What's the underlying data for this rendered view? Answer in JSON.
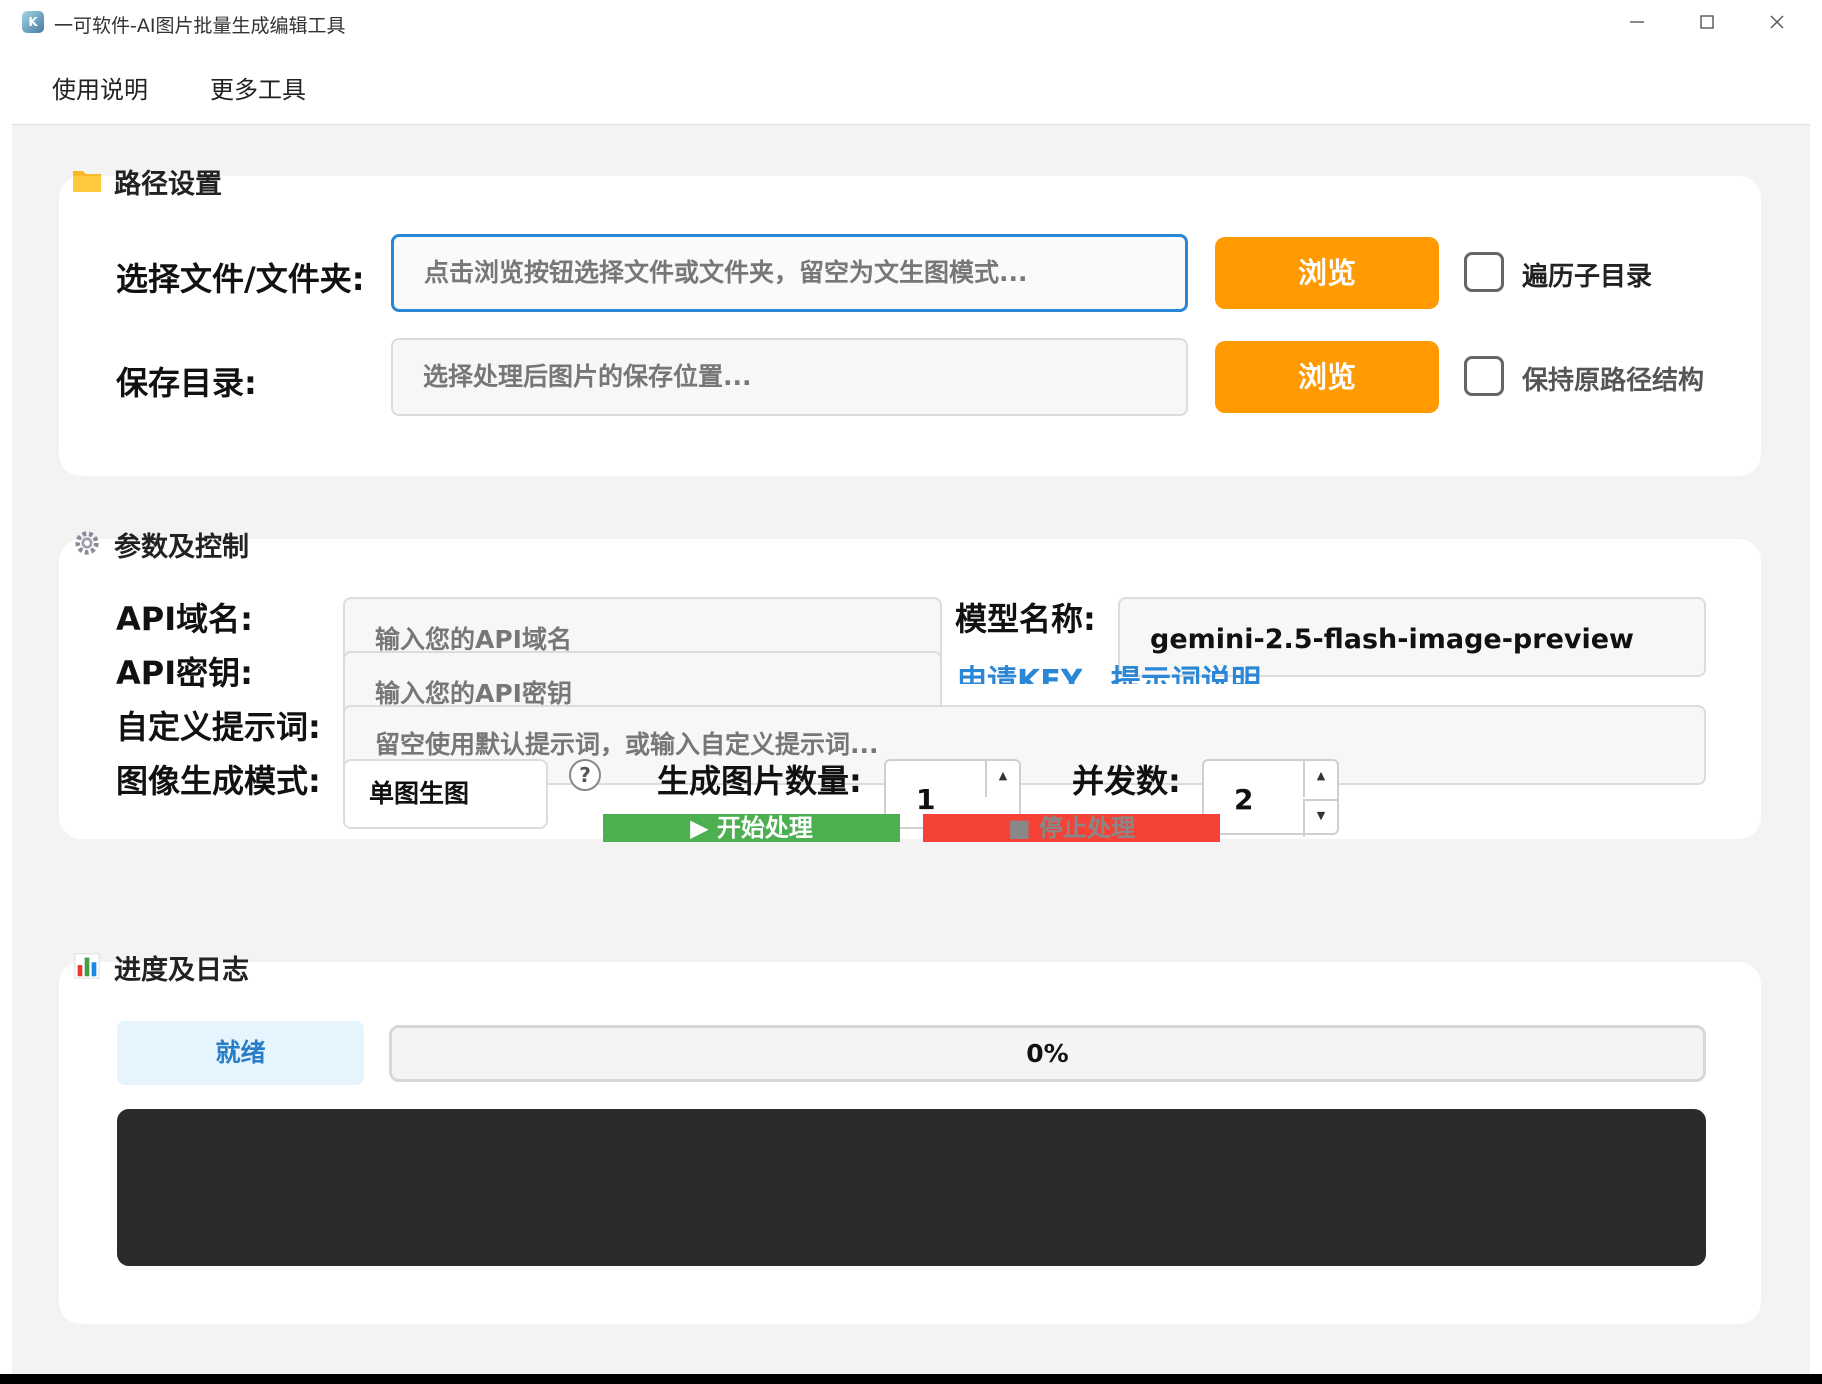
{
  "window": {
    "title": "一可软件-AI图片批量生成编辑工具"
  },
  "menu": [
    "使用说明",
    "更多工具"
  ],
  "path_section": {
    "title": "路径设置",
    "file_label": "选择文件/文件夹:",
    "file_placeholder": "点击浏览按钮选择文件或文件夹，留空为文生图模式...",
    "browse_label": "浏览",
    "recursive_label": "遍历子目录",
    "save_label": "保存目录:",
    "save_placeholder": "选择处理后图片的保存位置...",
    "browse2_label": "浏览",
    "keep_struct_label": "保持原路径结构"
  },
  "params_section": {
    "title": "参数及控制",
    "api_domain_label": "API域名:",
    "api_domain_placeholder": "输入您的API域名",
    "api_key_label": "API密钥:",
    "api_key_placeholder": "输入您的API密钥",
    "model_label": "模型名称:",
    "model_value": "gemini-2.5-flash-image-preview",
    "apply_key_link": "申请KEY",
    "prompt_help_link": "提示词说明",
    "prompt_label": "自定义提示词:",
    "prompt_placeholder": "留空使用默认提示词，或输入自定义提示词...",
    "mode_label": "图像生成模式:",
    "mode_value": "单图生图",
    "help_glyph": "?",
    "count_label": "生成图片数量:",
    "count_value": "1",
    "concurrency_label": "并发数:",
    "concurrency_value": "2",
    "start_label": "▶ 开始处理",
    "stop_label": "■ 停止处理"
  },
  "progress_section": {
    "title": "进度及日志",
    "status": "就绪",
    "progress_text": "0%",
    "progress_fraction": 0
  },
  "colors": {
    "accent_orange": "#ff9a00",
    "link_blue": "#2a86d6",
    "start_green": "#4caf50",
    "stop_red": "#f44336",
    "log_bg": "#2b2b2b"
  }
}
